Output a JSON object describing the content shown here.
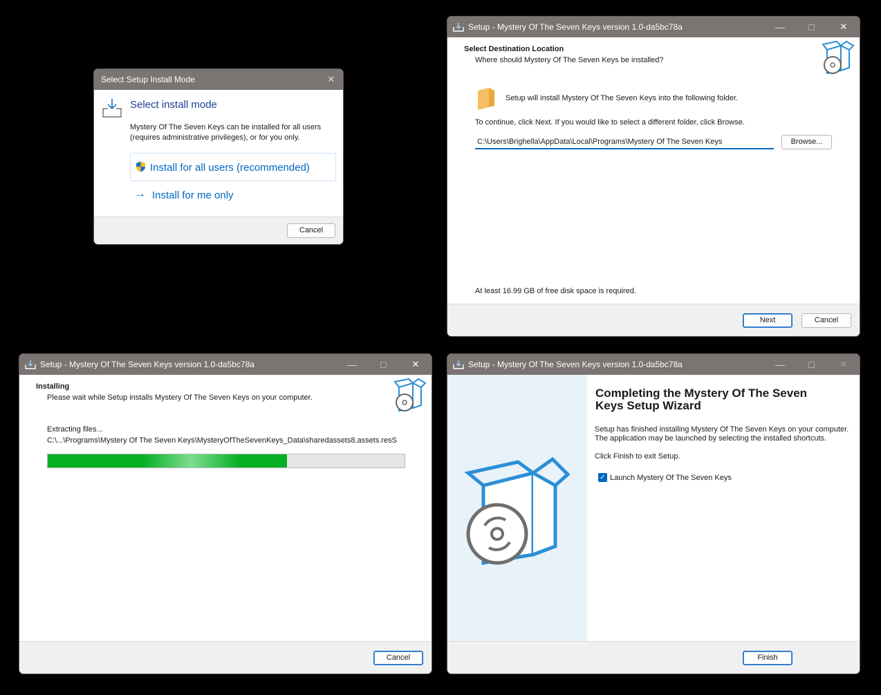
{
  "mode_dialog": {
    "title": "Select Setup Install Mode",
    "heading": "Select install mode",
    "description_line1": "Mystery Of The Seven Keys can be installed for all users",
    "description_line2": "(requires administrative privileges), or for you only.",
    "option_all_users": "Install for all users (recommended)",
    "option_me_only": "Install for me only",
    "cancel_label": "Cancel",
    "close_glyph": "✕"
  },
  "destination_window": {
    "title": "Setup - Mystery Of The Seven Keys version 1.0-da5bc78a",
    "header_title": "Select Destination Location",
    "header_subtitle": "Where should Mystery Of The Seven Keys be installed?",
    "info_text": "Setup will install Mystery Of The Seven Keys into the following folder.",
    "continue_text": "To continue, click Next. If you would like to select a different folder, click Browse.",
    "path_value": "C:\\Users\\Brighella\\AppData\\Local\\Programs\\Mystery Of The Seven Keys",
    "browse_label": "Browse...",
    "disk_space_text": "At least 16.99 GB of free disk space is required.",
    "next_label": "Next",
    "cancel_label": "Cancel",
    "min_glyph": "—",
    "close_glyph": "✕"
  },
  "installing_window": {
    "title": "Setup - Mystery Of The Seven Keys version 1.0-da5bc78a",
    "header_title": "Installing",
    "header_subtitle": "Please wait while Setup installs Mystery Of The Seven Keys on your computer.",
    "status_text": "Extracting files...",
    "file_path": "C:\\...\\Programs\\Mystery Of The Seven Keys\\MysteryOfTheSevenKeys_Data\\sharedassets8.assets.resS",
    "progress_percent": 67,
    "cancel_label": "Cancel",
    "min_glyph": "—",
    "close_glyph": "✕"
  },
  "finish_window": {
    "title": "Setup - Mystery Of The Seven Keys version 1.0-da5bc78a",
    "heading_line1": "Completing the Mystery Of The Seven",
    "heading_line2": "Keys Setup Wizard",
    "finished_line1": "Setup has finished installing Mystery Of The Seven Keys on your computer.",
    "finished_line2": "The application may be launched by selecting the installed shortcuts.",
    "click_finish_text": "Click Finish to exit Setup.",
    "launch_label": "Launch Mystery Of The Seven Keys",
    "launch_checked": true,
    "finish_label": "Finish",
    "min_glyph": "—",
    "close_glyph": "✕"
  },
  "colors": {
    "titlebar": "#7a7572",
    "accent_blue": "#0067c0",
    "progress_green": "#06b025",
    "box_icon_blue": "#2b8fd6"
  }
}
